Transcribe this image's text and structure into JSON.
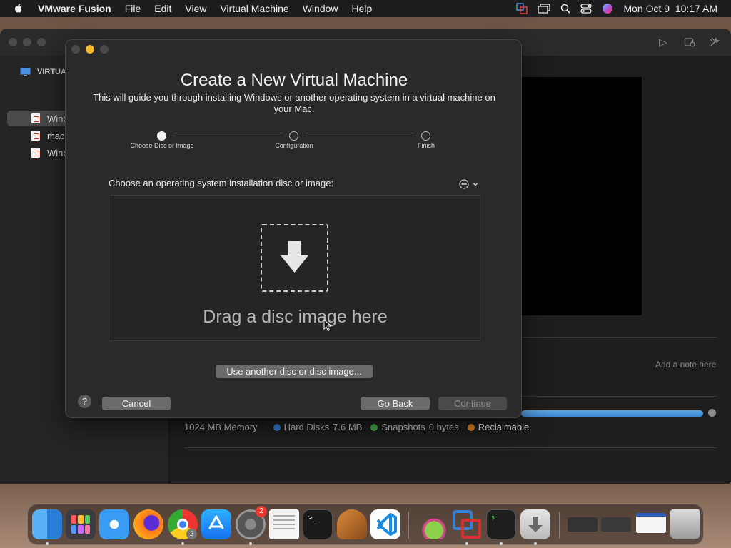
{
  "menubar": {
    "app_name": "VMware Fusion",
    "items": [
      "File",
      "Edit",
      "View",
      "Virtual Machine",
      "Window",
      "Help"
    ],
    "clock": "Mon Oct 9  10:17 AM"
  },
  "sidebar": {
    "header": "VIRTUA",
    "items": [
      {
        "label": "Winc"
      },
      {
        "label": "mac"
      },
      {
        "label": "Winc"
      }
    ]
  },
  "details": {
    "note_placeholder": "Add a note here",
    "memory": "1024 MB Memory",
    "legend": [
      {
        "label": "Hard Disks",
        "value": "7.6 MB",
        "color": "#3b82d6"
      },
      {
        "label": "Snapshots",
        "value": "0 bytes",
        "color": "#4caf50"
      },
      {
        "label": "Reclaimable",
        "value": "",
        "color": "#e08a2a"
      }
    ]
  },
  "dialog": {
    "title": "Create a New Virtual Machine",
    "subtitle": "This will guide you through installing Windows or another operating system in a virtual machine on your Mac.",
    "steps": [
      {
        "label": "Choose Disc or Image",
        "active": true
      },
      {
        "label": "Configuration",
        "active": false
      },
      {
        "label": "Finish",
        "active": false
      }
    ],
    "choose_label": "Choose an operating system installation disc or image:",
    "drop_text": "Drag a disc image here",
    "use_another_button": "Use another disc or disc image...",
    "help_button": "?",
    "cancel_button": "Cancel",
    "go_back_button": "Go Back",
    "continue_button": "Continue"
  },
  "dock": {
    "apps": [
      "Finder",
      "Launchpad",
      "Safari",
      "Firefox",
      "Chrome",
      "App Store",
      "System Settings",
      "TextEdit",
      "Terminal",
      "GarageBand",
      "Visual Studio Code",
      "Xcode Cloud",
      "VMware Fusion",
      "Console",
      "Downloads",
      "Trash"
    ],
    "settings_badge": "2",
    "chrome_badge": "2"
  },
  "colors": {
    "accent": "#3b86d0",
    "traffic_minimize": "#f5b82e"
  }
}
